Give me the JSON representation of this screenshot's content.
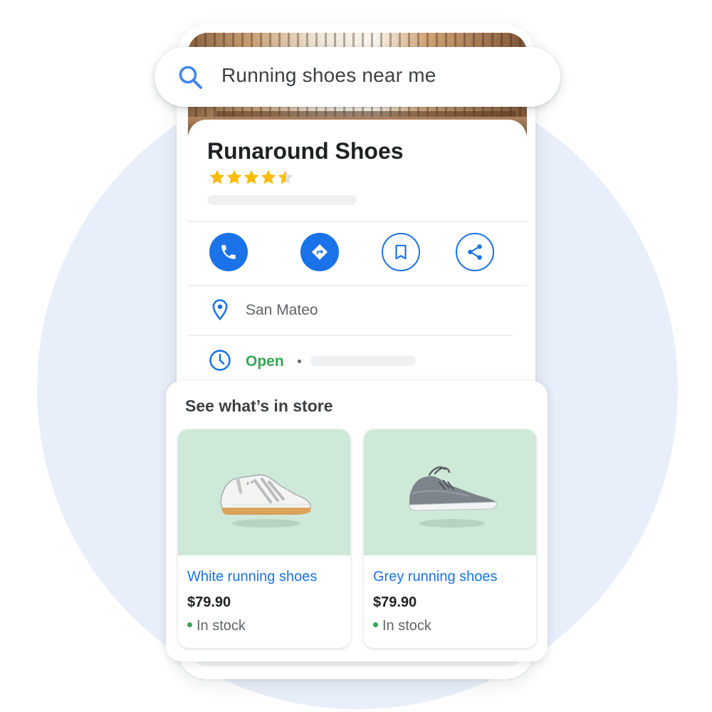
{
  "search": {
    "query": "Running shoes near me",
    "icon": "search-icon"
  },
  "place": {
    "name": "Runaround Shoes",
    "rating": 4.5,
    "rating_max": 5,
    "actions": [
      {
        "name": "call",
        "icon": "phone-icon",
        "style": "filled"
      },
      {
        "name": "directions",
        "icon": "directions-icon",
        "style": "filled"
      },
      {
        "name": "save",
        "icon": "bookmark-icon",
        "style": "outlined"
      },
      {
        "name": "share",
        "icon": "share-icon",
        "style": "outlined"
      }
    ],
    "location": "San Mateo",
    "status": "Open",
    "status_separator": "•"
  },
  "in_store": {
    "title": "See what’s in store",
    "products": [
      {
        "name": "White running shoes",
        "price": "$79.90",
        "stock": "In stock"
      },
      {
        "name": "Grey running shoes",
        "price": "$79.90",
        "stock": "In stock"
      }
    ]
  },
  "colors": {
    "accent": "#1a73e8",
    "open_green": "#34a853",
    "star": "#fbbc04",
    "background_circle": "#e8effb",
    "product_bg": "#cfe9d8"
  }
}
